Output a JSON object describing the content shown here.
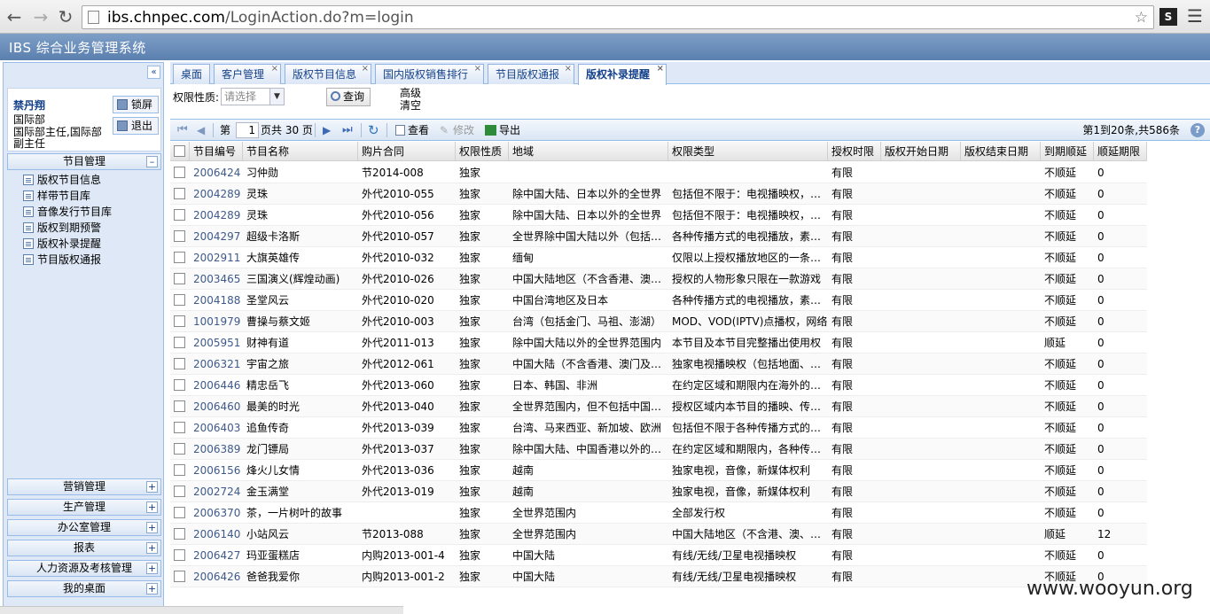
{
  "browser": {
    "url_host": "ibs.chnpec.com",
    "url_path": "/LoginAction.do?m=login",
    "ext_label": "S"
  },
  "app": {
    "title": "IBS 综合业务管理系统"
  },
  "sidebar": {
    "collapse_glyph": "«",
    "user_name": "禁丹翔",
    "user_dept": "国际部",
    "user_title": "国际部主任,国际部副主任",
    "lock_label": "锁屏",
    "logout_label": "退出",
    "program_group": "节目管理",
    "program_items": [
      "版权节目信息",
      "样带节目库",
      "音像发行节目库",
      "版权到期预警",
      "版权补录提醒",
      "节目版权通报"
    ],
    "other_groups": [
      "营销管理",
      "生产管理",
      "办公室管理",
      "报表",
      "人力资源及考核管理",
      "我的桌面"
    ]
  },
  "tabs": [
    {
      "label": "桌面",
      "closable": false
    },
    {
      "label": "客户管理",
      "closable": true
    },
    {
      "label": "版权节目信息",
      "closable": true
    },
    {
      "label": "国内版权销售排行",
      "closable": true
    },
    {
      "label": "节目版权通报",
      "closable": true
    },
    {
      "label": "版权补录提醒",
      "closable": true,
      "active": true
    }
  ],
  "filter": {
    "label": "权限性质:",
    "placeholder": "请选择",
    "query_label": "查询",
    "advanced_label": "高级",
    "clear_label": "清空"
  },
  "toolbar": {
    "page_prefix": "第",
    "page_value": "1",
    "page_suffix": "页共 30 页",
    "view_label": "查看",
    "edit_label": "修改",
    "export_label": "导出",
    "status": "第1到20条,共586条"
  },
  "grid": {
    "columns": [
      "节目编号",
      "节目名称",
      "购片合同",
      "权限性质",
      "地域",
      "权限类型",
      "授权时限",
      "版权开始日期",
      "版权结束日期",
      "到期顺延",
      "顺延期限"
    ],
    "rows": [
      [
        "2006424",
        "习仲勋",
        "节2014-008",
        "独家",
        "",
        "",
        "有限",
        "",
        "",
        "不顺延",
        "0"
      ],
      [
        "2004289",
        "灵珠",
        "外代2010-055",
        "独家",
        "除中国大陆、日本以外的全世界",
        "包括但不限于：电视播映权，音像",
        "有限",
        "",
        "",
        "不顺延",
        "0"
      ],
      [
        "2004289",
        "灵珠",
        "外代2010-056",
        "独家",
        "除中国大陆、日本以外的全世界",
        "包括但不限于：电视播映权，音像",
        "有限",
        "",
        "",
        "不顺延",
        "0"
      ],
      [
        "2004297",
        "超级卡洛斯",
        "外代2010-057",
        "独家",
        "全世界除中国大陆以外（包括港澳台）",
        "各种传播方式的电视播放，素材使用",
        "有限",
        "",
        "",
        "不顺延",
        "0"
      ],
      [
        "2002911",
        "大旗英雄传",
        "外代2010-032",
        "独家",
        "缅甸",
        "仅限以上授权播放地区的一条频道",
        "有限",
        "",
        "",
        "不顺延",
        "0"
      ],
      [
        "2003465",
        "三国演义(辉煌动画)",
        "外代2010-026",
        "独家",
        "中国大陆地区（不含香港、澳门）",
        "授权的人物形象只限在一款游戏",
        "有限",
        "",
        "",
        "不顺延",
        "0"
      ],
      [
        "2004188",
        "圣堂风云",
        "外代2010-020",
        "独家",
        "中国台湾地区及日本",
        "各种传播方式的电视播放，素材使用",
        "有限",
        "",
        "",
        "不顺延",
        "0"
      ],
      [
        "1001979",
        "曹操与蔡文姬",
        "外代2010-003",
        "独家",
        "台湾（包括金门、马祖、澎湖）",
        "MOD、VOD(IPTV)点播权，网络",
        "有限",
        "",
        "",
        "不顺延",
        "0"
      ],
      [
        "2005951",
        "财神有道",
        "外代2011-013",
        "独家",
        "除中国大陆以外的全世界范围内",
        "本节目及本节目完整播出使用权",
        "有限",
        "",
        "",
        "顺延",
        "0"
      ],
      [
        "2006321",
        "宇宙之旅",
        "外代2012-061",
        "独家",
        "中国大陆（不含香港、澳门及台湾）",
        "独家电视播映权（包括地面、卫星）",
        "有限",
        "",
        "",
        "不顺延",
        "0"
      ],
      [
        "2006446",
        "精忠岳飞",
        "外代2013-060",
        "独家",
        "日本、韩国、非洲",
        "在约定区域和期限内在海外的电视",
        "有限",
        "",
        "",
        "不顺延",
        "0"
      ],
      [
        "2006460",
        "最美的时光",
        "外代2013-040",
        "独家",
        "全世界范围内，但不包括中国大陆",
        "授权区域内本节目的播映、传播权",
        "有限",
        "",
        "",
        "不顺延",
        "0"
      ],
      [
        "2006403",
        "追鱼传奇",
        "外代2013-039",
        "独家",
        "台湾、马来西亚、新加坡、欧洲",
        "包括但不限于各种传播方式的电视",
        "有限",
        "",
        "",
        "不顺延",
        "0"
      ],
      [
        "2006389",
        "龙门镖局",
        "外代2013-037",
        "独家",
        "除中国大陆、中国香港以外的全世界",
        "在约定区域和期限内，各种传播方式",
        "有限",
        "",
        "",
        "不顺延",
        "0"
      ],
      [
        "2006156",
        "烽火儿女情",
        "外代2013-036",
        "独家",
        "越南",
        "独家电视，音像，新媒体权利",
        "有限",
        "",
        "",
        "不顺延",
        "0"
      ],
      [
        "2002724",
        "金玉满堂",
        "外代2013-019",
        "独家",
        "越南",
        "独家电视，音像，新媒体权利",
        "有限",
        "",
        "",
        "不顺延",
        "0"
      ],
      [
        "2006370",
        "茶，一片树叶的故事",
        "",
        "独家",
        "全世界范围内",
        "全部发行权",
        "有限",
        "",
        "",
        "不顺延",
        "0"
      ],
      [
        "2006140",
        "小站风云",
        "节2013-088",
        "独家",
        "全世界范围内",
        "中国大陆地区（不含港、澳、台）",
        "有限",
        "",
        "",
        "顺延",
        "12"
      ],
      [
        "2006427",
        "玛亚蛋糕店",
        "内购2013-001-4",
        "独家",
        "中国大陆",
        "有线/无线/卫星电视播映权",
        "有限",
        "",
        "",
        "不顺延",
        "0"
      ],
      [
        "2006426",
        "爸爸我爱你",
        "内购2013-001-2",
        "独家",
        "中国大陆",
        "有线/无线/卫星电视播映权",
        "有限",
        "",
        "",
        "不顺延",
        "0"
      ]
    ]
  },
  "watermark": "www.wooyun.org"
}
